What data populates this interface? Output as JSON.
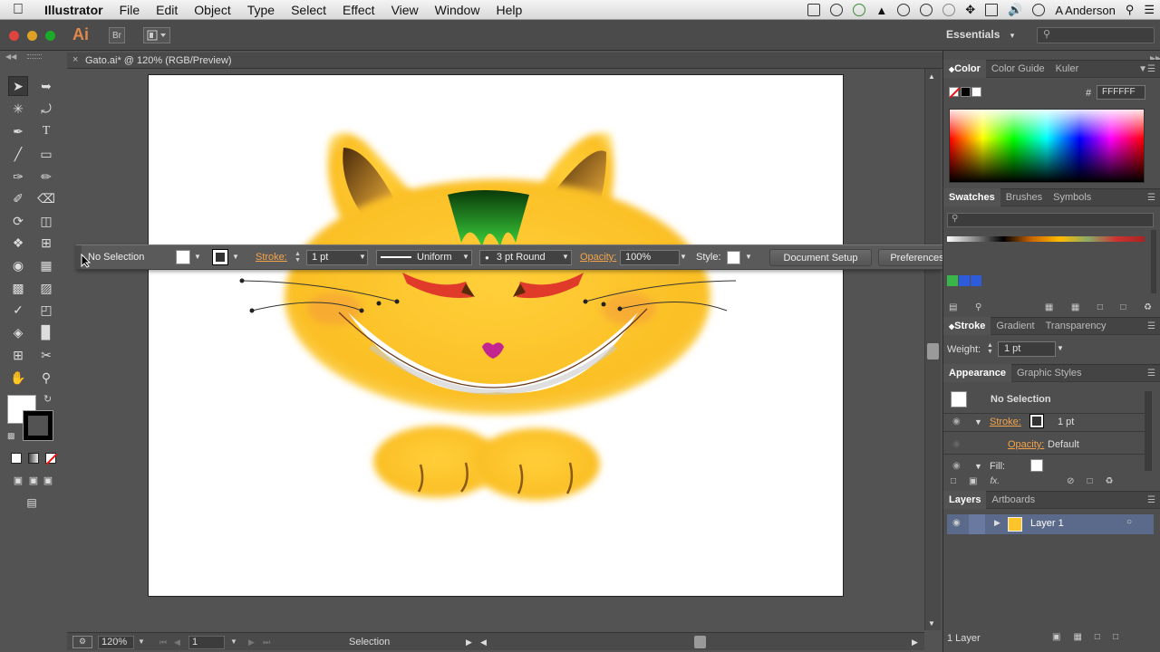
{
  "menubar": {
    "app": "Illustrator",
    "items": [
      "File",
      "Edit",
      "Object",
      "Type",
      "Select",
      "Effect",
      "View",
      "Window",
      "Help"
    ],
    "user": "A Anderson"
  },
  "appbar": {
    "logo": "Ai",
    "bridge": "Br",
    "workspace": "Essentials",
    "workspace_arrow": "▾"
  },
  "document": {
    "tab_title": "Gato.ai* @ 120% (RGB/Preview)",
    "close": "×"
  },
  "controlbar": {
    "selection": "No Selection",
    "stroke_label": "Stroke:",
    "stroke_value": "1 pt",
    "profile": "Uniform",
    "brush": "3 pt Round",
    "opacity_label": "Opacity:",
    "opacity_value": "100%",
    "style_label": "Style:",
    "doc_setup": "Document Setup",
    "preferences": "Preferences"
  },
  "statusbar": {
    "zoom": "120%",
    "artboard": "1",
    "tool": "Selection"
  },
  "color_panel": {
    "tabs": [
      "Color",
      "Color Guide",
      "Kuler"
    ],
    "hash": "#",
    "hex": "FFFFFF"
  },
  "swatches_panel": {
    "tabs": [
      "Swatches",
      "Brushes",
      "Symbols"
    ]
  },
  "stroke_panel": {
    "tabs": [
      "Stroke",
      "Gradient",
      "Transparency"
    ],
    "weight_label": "Weight:",
    "weight_value": "1 pt"
  },
  "appearance_panel": {
    "tabs": [
      "Appearance",
      "Graphic Styles"
    ],
    "title": "No Selection",
    "stroke_label": "Stroke:",
    "stroke_value": "1 pt",
    "opacity_label": "Opacity:",
    "opacity_value": "Default",
    "fill_label": "Fill:"
  },
  "layers_panel": {
    "tabs": [
      "Layers",
      "Artboards"
    ],
    "layer_name": "Layer 1",
    "count": "1 Layer"
  },
  "colors": {
    "accent": "#f3a44b",
    "cat_body": "#fcc42a",
    "layer_highlight": "#5b6a8a"
  }
}
